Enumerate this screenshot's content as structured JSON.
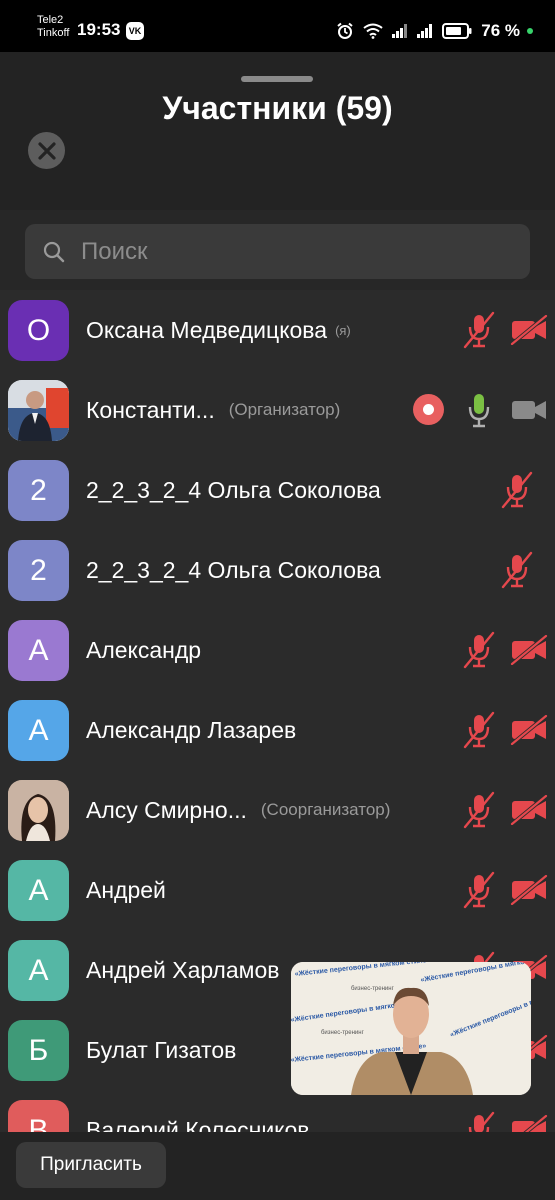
{
  "status_bar": {
    "carrier_1": "Tele2",
    "carrier_2": "Tinkoff",
    "time": "19:53",
    "vk_badge": "VK",
    "battery_percent": "76 %"
  },
  "sheet": {
    "title": "Участники (59)",
    "search_placeholder": "Поиск"
  },
  "participants": [
    {
      "avatar_letter": "О",
      "avatar_color": "#6a2fb3",
      "name": "Оксана Медведицкова",
      "role": "(я)",
      "mic": "muted",
      "camera": "off"
    },
    {
      "avatar_letter": "",
      "avatar_type": "photo",
      "name": "Константи...",
      "role": "(Организатор)",
      "recording": true,
      "mic": "active",
      "camera": "on"
    },
    {
      "avatar_letter": "2",
      "avatar_color": "#7d86c8",
      "name": "2_2_3_2_4 Ольга Соколова",
      "role": "",
      "mic": "muted",
      "camera": "none"
    },
    {
      "avatar_letter": "2",
      "avatar_color": "#7d86c8",
      "name": "2_2_3_2_4 Ольга Соколова",
      "role": "",
      "mic": "muted",
      "camera": "none"
    },
    {
      "avatar_letter": "А",
      "avatar_color": "#9a79d1",
      "name": "Александр",
      "role": "",
      "mic": "muted",
      "camera": "off"
    },
    {
      "avatar_letter": "А",
      "avatar_color": "#55a6e8",
      "name": "Александр Лазарев",
      "role": "",
      "mic": "muted",
      "camera": "off"
    },
    {
      "avatar_letter": "",
      "avatar_type": "photo",
      "name": "Алсу Смирно...",
      "role": "(Соорганизатор)",
      "mic": "muted",
      "camera": "off"
    },
    {
      "avatar_letter": "А",
      "avatar_color": "#55b7a5",
      "name": "Андрей",
      "role": "",
      "mic": "muted",
      "camera": "off"
    },
    {
      "avatar_letter": "А",
      "avatar_color": "#55b7a5",
      "name": "Андрей Харламов",
      "role": "",
      "mic": "muted",
      "camera": "off"
    },
    {
      "avatar_letter": "Б",
      "avatar_color": "#3f9a78",
      "name": "Булат Гизатов",
      "role": "",
      "mic": "muted",
      "camera": "off"
    },
    {
      "avatar_letter": "В",
      "avatar_color": "#e05c5c",
      "name": "Валерий Колесников",
      "role": "",
      "mic": "muted",
      "camera": "off"
    }
  ],
  "pip": {
    "banner_text": "«Жёсткие переговоры в мягком стиле»",
    "banner_sub": "бизнес-тренинг"
  },
  "bottom_bar": {
    "invite_label": "Пригласить"
  },
  "colors": {
    "muted_red": "#e5484d",
    "mic_active_green": "#7bc043",
    "record_red": "#e86060",
    "sheet_background": "#232323"
  }
}
